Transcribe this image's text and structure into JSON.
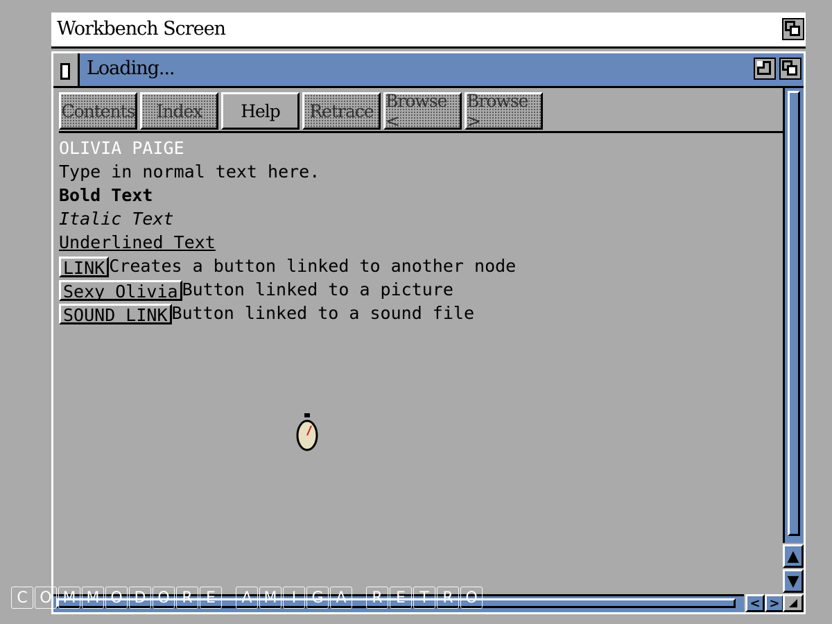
{
  "screen": {
    "title": "Workbench Screen"
  },
  "window": {
    "title": "Loading..."
  },
  "toolbar": {
    "buttons": [
      {
        "label": "Contents",
        "enabled": false
      },
      {
        "label": "Index",
        "enabled": false
      },
      {
        "label": "Help",
        "enabled": true
      },
      {
        "label": "Retrace",
        "enabled": false
      },
      {
        "label": "Browse <",
        "enabled": false
      },
      {
        "label": "Browse >",
        "enabled": false
      }
    ]
  },
  "document": {
    "heading": "OLIVIA PAIGE",
    "normal": "Type in normal text here.",
    "bold": "Bold Text",
    "italic": "Italic Text",
    "underlined": "Underlined Text",
    "links": [
      {
        "button": "LINK",
        "description": "Creates a button linked to another node"
      },
      {
        "button": "Sexy Olivia",
        "description": "Button linked to a picture"
      },
      {
        "button": "SOUND LINK",
        "description": "Button linked to a sound file"
      }
    ]
  },
  "scrollbar": {
    "up": "▲",
    "down": "▼",
    "left": "<",
    "right": ">"
  },
  "watermark": {
    "words": [
      "COMMODORE",
      "AMIGA",
      "RETRO"
    ]
  },
  "icons": {
    "pointer": "stopwatch-busy-icon",
    "screen_depth": "depth-arrange-icon",
    "window_close": "close-gadget-icon",
    "window_zoom": "zoom-gadget-icon",
    "window_depth": "depth-arrange-icon",
    "resize": "resize-gadget-icon"
  },
  "colors": {
    "workbench_grey": "#aaaaaa",
    "title_blue": "#6688bb",
    "black": "#000000",
    "white": "#ffffff"
  }
}
